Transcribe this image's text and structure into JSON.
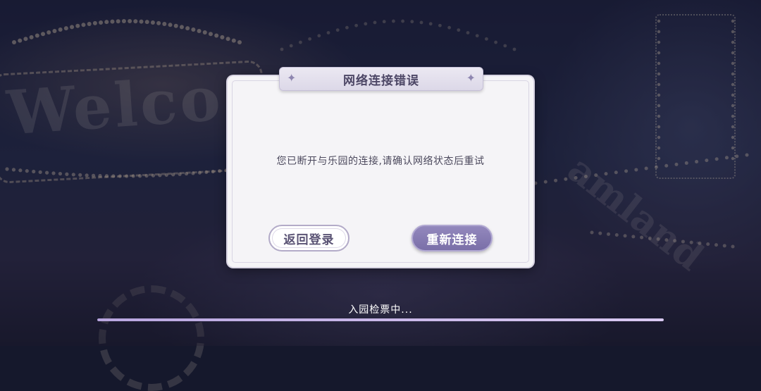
{
  "background": {
    "sign_text": "Welco",
    "sign_text_right": "amland"
  },
  "dialog": {
    "title": "网络连接错误",
    "title_ornament": "✦",
    "message": "您已断开与乐园的连接,请确认网络状态后重试",
    "back_button": "返回登录",
    "retry_button": "重新连接"
  },
  "loading": {
    "status_text": "入园检票中...",
    "progress_percent": 100
  },
  "colors": {
    "accent": "#7a6fa8",
    "dialog_bg": "#f5f4f7",
    "title_text": "#4d4766"
  }
}
